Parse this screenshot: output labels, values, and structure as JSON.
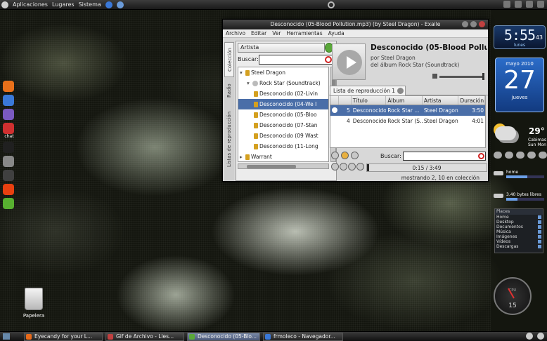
{
  "top_panel": {
    "menus": [
      "Aplicaciones",
      "Lugares",
      "Sistema"
    ]
  },
  "dock": {
    "items": [
      {
        "name": "firefox-icon",
        "color": "#e8701a"
      },
      {
        "name": "messenger-icon",
        "color": "#3a78d8"
      },
      {
        "name": "pidgin-icon",
        "color": "#7a5ac0"
      },
      {
        "name": "chat-icon",
        "color": "#d03030",
        "label": "chat"
      },
      {
        "name": "skype-icon",
        "color": "#202020"
      },
      {
        "name": "lock-icon",
        "color": "#888888"
      },
      {
        "name": "music-icon",
        "color": "#404040"
      },
      {
        "name": "ubuntu-icon",
        "color": "#e84010"
      },
      {
        "name": "notes-icon",
        "color": "#58b030"
      }
    ]
  },
  "trash": {
    "label": "Papelera"
  },
  "window": {
    "title": "Desconocido (05-Blood Pollution.mp3) (by Steel Dragon) - Exaile",
    "menus": [
      "Archivo",
      "Editar",
      "Ver",
      "Herramientas",
      "Ayuda"
    ],
    "side_tabs": [
      "Colección",
      "Radio",
      "Listas de reproducción"
    ],
    "collection": {
      "combo": "Artista",
      "search_label": "Buscar:",
      "search_value": "",
      "tree": [
        {
          "indent": 0,
          "text": "Steel Dragon",
          "expanded": true,
          "type": "artist"
        },
        {
          "indent": 1,
          "text": "Rock Star (Soundtrack)",
          "expanded": true,
          "type": "album"
        },
        {
          "indent": 2,
          "text": "Desconocido (02-Livin",
          "type": "track"
        },
        {
          "indent": 2,
          "text": "Desconocido (04-We I",
          "type": "track",
          "selected": true
        },
        {
          "indent": 2,
          "text": "Desconocido (05-Bloo",
          "type": "track"
        },
        {
          "indent": 2,
          "text": "Desconocido (07-Stan",
          "type": "track"
        },
        {
          "indent": 2,
          "text": "Desconocido (09 Wast",
          "type": "track"
        },
        {
          "indent": 2,
          "text": "Desconocido (11-Long",
          "type": "track"
        },
        {
          "indent": 0,
          "text": "Warrant",
          "expanded": false,
          "type": "artist"
        }
      ]
    },
    "now_playing": {
      "title": "Desconocido (05-Blood Pollution.",
      "by": "por Steel Dragon",
      "album": "del álbum Rock Star (Soundtrack)",
      "volume": 1.0
    },
    "playlist_tab": "Lista de reproducción 1",
    "playlist": {
      "columns": [
        "#",
        "Título",
        "Álbum",
        "Artista",
        "Duración"
      ],
      "rows": [
        {
          "playing": true,
          "num": "5",
          "title": "Desconocido",
          "album": "Rock Star ...",
          "artist": "Steel Dragon",
          "duration": "3:50",
          "selected": true
        },
        {
          "playing": false,
          "num": "4",
          "title": "Desconocido",
          "album": "Rock Star (S...",
          "artist": "Steel Dragon",
          "duration": "4:01",
          "selected": false
        }
      ]
    },
    "search_label": "Buscar:",
    "search_value": "",
    "position": "0:15 / 3:49",
    "progress": 0.02,
    "status": "mostrando 2, 10 en colección"
  },
  "widgets": {
    "clock": {
      "time": "5:55",
      "seconds": "43",
      "day": "lunes"
    },
    "calendar": {
      "month": "mayo 2010",
      "day": "27",
      "weekday": "jueves"
    },
    "weather": {
      "temp": "29°",
      "city": "Cabimas Sun Mon"
    },
    "drives": [
      {
        "label": "home",
        "used": 0.55
      },
      {
        "label": "3.40 bytes libres",
        "used": 0.3
      }
    ],
    "places": {
      "header": "Places",
      "items": [
        "Home",
        "Desktop",
        "Documentos",
        "Música",
        "Imágenes",
        "Vídeos",
        "Descargas"
      ]
    },
    "cpu": {
      "label": "CPU",
      "value": "15"
    }
  },
  "taskbar": {
    "tasks": [
      {
        "label": "Eyecandy for your L...",
        "color": "#e86a1a",
        "active": false
      },
      {
        "label": "Gif de Archivo - Lles...",
        "color": "#c04040",
        "active": false
      },
      {
        "label": "Desconocido (05-Blo...",
        "color": "#5aa83a",
        "active": true
      },
      {
        "label": "frmoleco - Navegador...",
        "color": "#3a78d8",
        "active": false
      }
    ]
  }
}
